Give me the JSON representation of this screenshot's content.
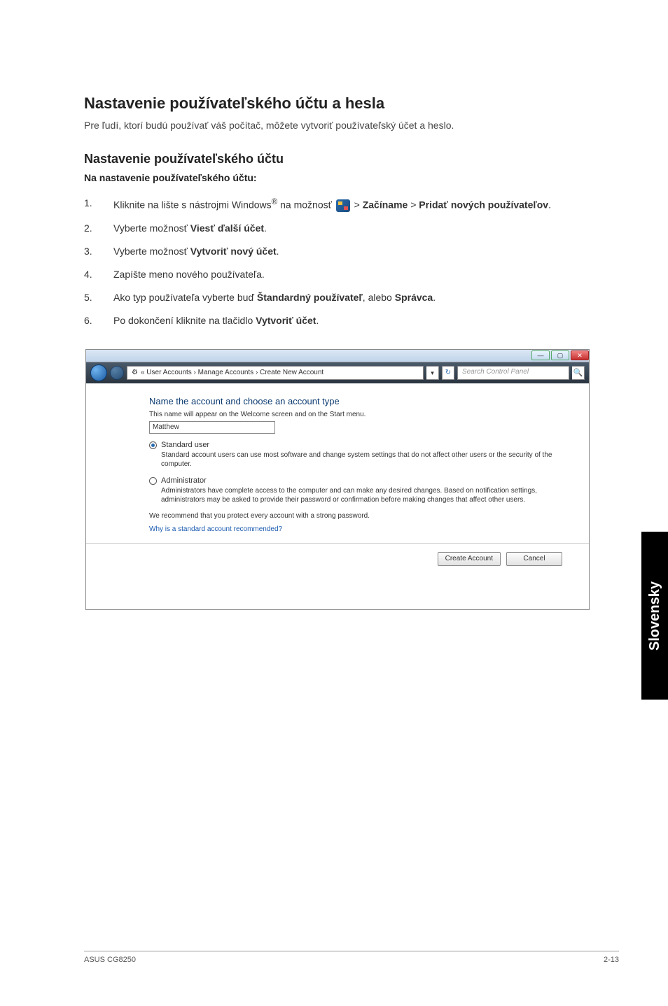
{
  "heading_main": "Nastavenie používateľského účtu a hesla",
  "intro": "Pre ľudí, ktorí budú používať váš počítač, môžete vytvoriť používateľský účet a heslo.",
  "heading_sub": "Nastavenie používateľského účtu",
  "sub_intro": "Na nastavenie používateľského účtu:",
  "steps": [
    {
      "n": "1.",
      "prefix": "Kliknite na lište s nástrojmi Windows",
      "sup": "®",
      "mid": " na možnosť ",
      "rest": " > ",
      "b1": "Začíname",
      "sep": " > ",
      "b2": "Pridať nových používateľov",
      "suffix": "."
    },
    {
      "n": "2.",
      "text": "Vyberte možnosť ",
      "b": "Viesť ďalší účet",
      "suffix": "."
    },
    {
      "n": "3.",
      "text": "Vyberte možnosť ",
      "b": "Vytvoriť nový účet",
      "suffix": "."
    },
    {
      "n": "4.",
      "text": "Zapíšte meno nového používateľa."
    },
    {
      "n": "5.",
      "text": "Ako typ používateľa vyberte buď ",
      "b": "Štandardný používateľ",
      "mid": ", alebo ",
      "b2": "Správca",
      "suffix": "."
    },
    {
      "n": "6.",
      "text": "Po dokončení kliknite na tlačidlo ",
      "b": "Vytvoriť účet",
      "suffix": "."
    }
  ],
  "window": {
    "breadcrumb_icon": "⚙",
    "breadcrumb": "« User Accounts › Manage Accounts › Create New Account",
    "dropdown": "▾",
    "refresh": "↻",
    "search_placeholder": "Search Control Panel",
    "search_icon": "🔍",
    "min": "—",
    "max": "▢",
    "close": "✕",
    "heading": "Name the account and choose an account type",
    "subtext": "This name will appear on the Welcome screen and on the Start menu.",
    "name_value": "Matthew",
    "opt1_label": "Standard user",
    "opt1_desc": "Standard account users can use most software and change system settings that do not affect other users or the security of the computer.",
    "opt2_label": "Administrator",
    "opt2_desc": "Administrators have complete access to the computer and can make any desired changes. Based on notification settings, administrators may be asked to provide their password or confirmation before making changes that affect other users.",
    "recommend": "We recommend that you protect every account with a strong password.",
    "link": "Why is a standard account recommended?",
    "btn_create": "Create Account",
    "btn_cancel": "Cancel"
  },
  "side_tab": "Slovensky",
  "footer_left": "ASUS CG8250",
  "footer_right": "2-13"
}
